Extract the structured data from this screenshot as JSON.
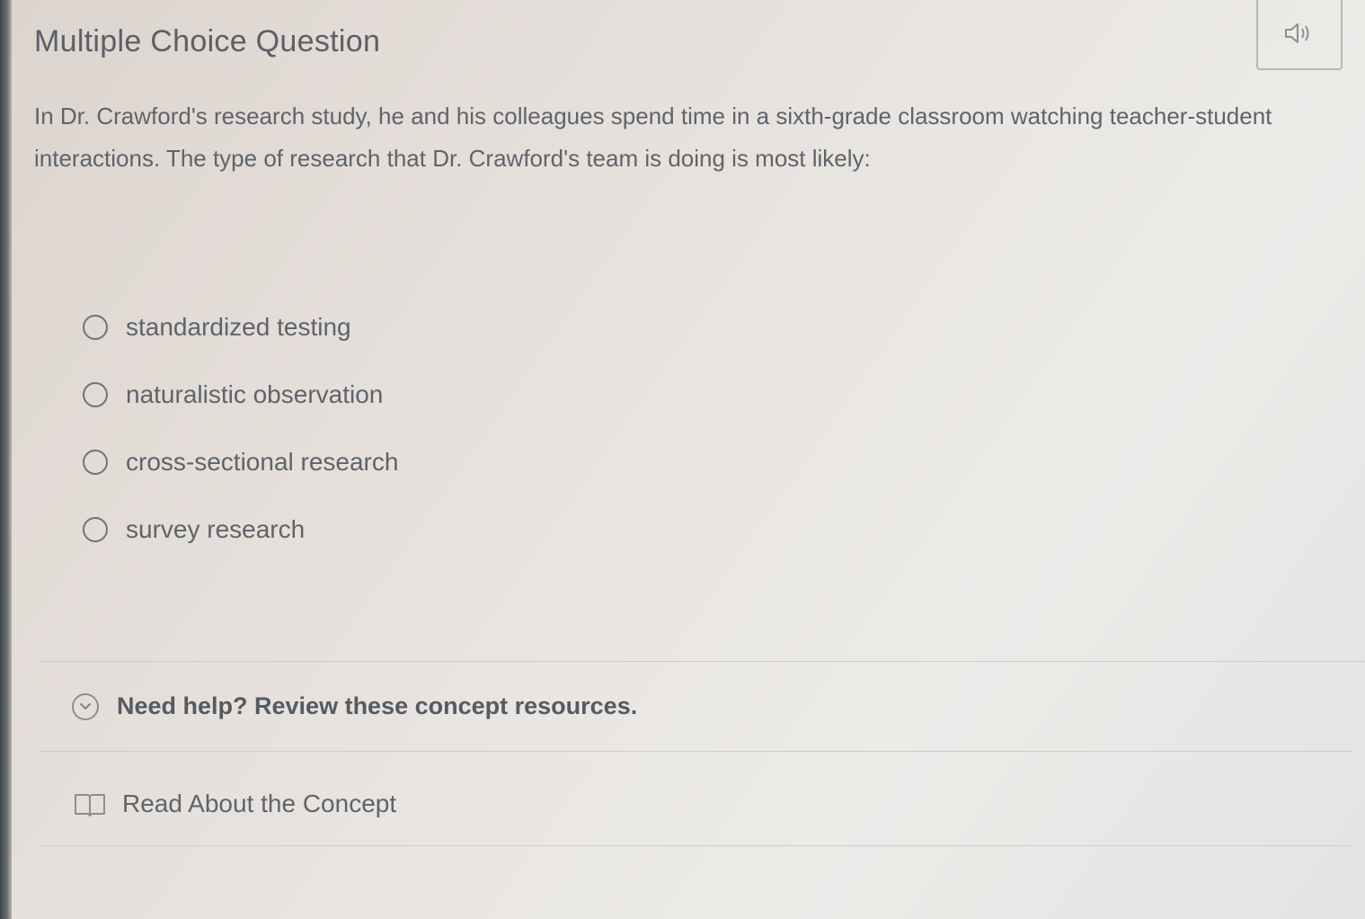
{
  "question": {
    "title": "Multiple Choice Question",
    "text": "In Dr. Crawford's research study, he and his colleagues spend time in a sixth-grade classroom watching teacher-student interactions. The type of research that Dr. Crawford's team is doing is most likely:"
  },
  "audio_button": {
    "icon": "speaker-icon"
  },
  "options": [
    {
      "label": "standardized testing"
    },
    {
      "label": "naturalistic observation"
    },
    {
      "label": "cross-sectional research"
    },
    {
      "label": "survey research"
    }
  ],
  "help": {
    "label": "Need help? Review these concept resources.",
    "icon": "chevron-down-icon"
  },
  "resources": {
    "read_label": "Read About the Concept",
    "icon": "book-icon"
  }
}
